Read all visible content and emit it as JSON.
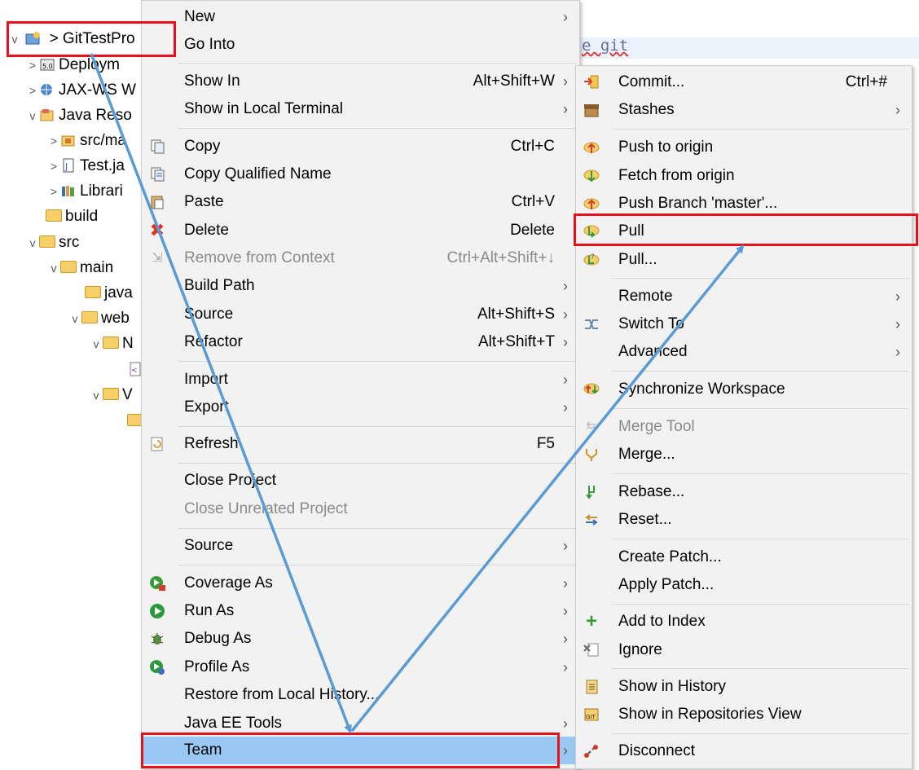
{
  "tree": {
    "project": "> GitTestPro",
    "items": [
      {
        "label": "Deploym",
        "twisty": ">"
      },
      {
        "label": "JAX-WS W",
        "twisty": ">"
      },
      {
        "label": "Java Reso",
        "twisty": "v"
      },
      {
        "label": "src/ma",
        "twisty": ">"
      },
      {
        "label": "Test.ja",
        "twisty": ">"
      },
      {
        "label": "Librari",
        "twisty": ">"
      },
      {
        "label": "build",
        "twisty": ""
      },
      {
        "label": "src",
        "twisty": "v"
      },
      {
        "label": "main",
        "twisty": "v"
      },
      {
        "label": "java",
        "twisty": ""
      },
      {
        "label": "web",
        "twisty": "v"
      },
      {
        "label": "N",
        "twisty": "v"
      },
      {
        "label": "",
        "twisty": ""
      },
      {
        "label": "V",
        "twisty": "v"
      },
      {
        "label": "",
        "twisty": ""
      }
    ]
  },
  "editor": {
    "text": "e git"
  },
  "context_menu": {
    "items": [
      {
        "label": "New",
        "shortcut": "",
        "arrow": "›"
      },
      {
        "label": "Go Into",
        "shortcut": "",
        "arrow": ""
      },
      {
        "label": "Show In",
        "shortcut": "Alt+Shift+W",
        "arrow": "›"
      },
      {
        "label": "Show in Local Terminal",
        "shortcut": "",
        "arrow": "›"
      },
      {
        "label": "Copy",
        "shortcut": "Ctrl+C",
        "arrow": ""
      },
      {
        "label": "Copy Qualified Name",
        "shortcut": "",
        "arrow": ""
      },
      {
        "label": "Paste",
        "shortcut": "Ctrl+V",
        "arrow": ""
      },
      {
        "label": "Delete",
        "shortcut": "Delete",
        "arrow": ""
      },
      {
        "label": "Remove from Context",
        "shortcut": "Ctrl+Alt+Shift+↓",
        "arrow": ""
      },
      {
        "label": "Build Path",
        "shortcut": "",
        "arrow": "›"
      },
      {
        "label": "Source",
        "shortcut": "Alt+Shift+S",
        "arrow": "›"
      },
      {
        "label": "Refactor",
        "shortcut": "Alt+Shift+T",
        "arrow": "›"
      },
      {
        "label": "Import",
        "shortcut": "",
        "arrow": "›"
      },
      {
        "label": "Export",
        "shortcut": "",
        "arrow": "›"
      },
      {
        "label": "Refresh",
        "shortcut": "F5",
        "arrow": ""
      },
      {
        "label": "Close Project",
        "shortcut": "",
        "arrow": ""
      },
      {
        "label": "Close Unrelated Project",
        "shortcut": "",
        "arrow": ""
      },
      {
        "label": "Source",
        "shortcut": "",
        "arrow": "›"
      },
      {
        "label": "Coverage As",
        "shortcut": "",
        "arrow": "›"
      },
      {
        "label": "Run As",
        "shortcut": "",
        "arrow": "›"
      },
      {
        "label": "Debug As",
        "shortcut": "",
        "arrow": "›"
      },
      {
        "label": "Profile As",
        "shortcut": "",
        "arrow": "›"
      },
      {
        "label": "Restore from Local History...",
        "shortcut": "",
        "arrow": ""
      },
      {
        "label": "Java EE Tools",
        "shortcut": "",
        "arrow": "›"
      },
      {
        "label": "Team",
        "shortcut": "",
        "arrow": "›"
      }
    ]
  },
  "team_menu": {
    "items": [
      {
        "label": "Commit...",
        "shortcut": "Ctrl+#",
        "arrow": ""
      },
      {
        "label": "Stashes",
        "shortcut": "",
        "arrow": "›"
      },
      {
        "label": "Push to origin",
        "shortcut": "",
        "arrow": ""
      },
      {
        "label": "Fetch from origin",
        "shortcut": "",
        "arrow": ""
      },
      {
        "label": "Push Branch 'master'...",
        "shortcut": "",
        "arrow": ""
      },
      {
        "label": "Pull",
        "shortcut": "",
        "arrow": ""
      },
      {
        "label": "Pull...",
        "shortcut": "",
        "arrow": ""
      },
      {
        "label": "Remote",
        "shortcut": "",
        "arrow": "›"
      },
      {
        "label": "Switch To",
        "shortcut": "",
        "arrow": "›"
      },
      {
        "label": "Advanced",
        "shortcut": "",
        "arrow": "›"
      },
      {
        "label": "Synchronize Workspace",
        "shortcut": "",
        "arrow": ""
      },
      {
        "label": "Merge Tool",
        "shortcut": "",
        "arrow": ""
      },
      {
        "label": "Merge...",
        "shortcut": "",
        "arrow": ""
      },
      {
        "label": "Rebase...",
        "shortcut": "",
        "arrow": ""
      },
      {
        "label": "Reset...",
        "shortcut": "",
        "arrow": ""
      },
      {
        "label": "Create Patch...",
        "shortcut": "",
        "arrow": ""
      },
      {
        "label": "Apply Patch...",
        "shortcut": "",
        "arrow": ""
      },
      {
        "label": "Add to Index",
        "shortcut": "",
        "arrow": ""
      },
      {
        "label": "Ignore",
        "shortcut": "",
        "arrow": ""
      },
      {
        "label": "Show in History",
        "shortcut": "",
        "arrow": ""
      },
      {
        "label": "Show in Repositories View",
        "shortcut": "",
        "arrow": ""
      },
      {
        "label": "Disconnect",
        "shortcut": "",
        "arrow": ""
      }
    ]
  },
  "colors": {
    "highlight_box": "#e8101a",
    "arrow": "#5b9bd5",
    "selected": "#99c9f3"
  }
}
